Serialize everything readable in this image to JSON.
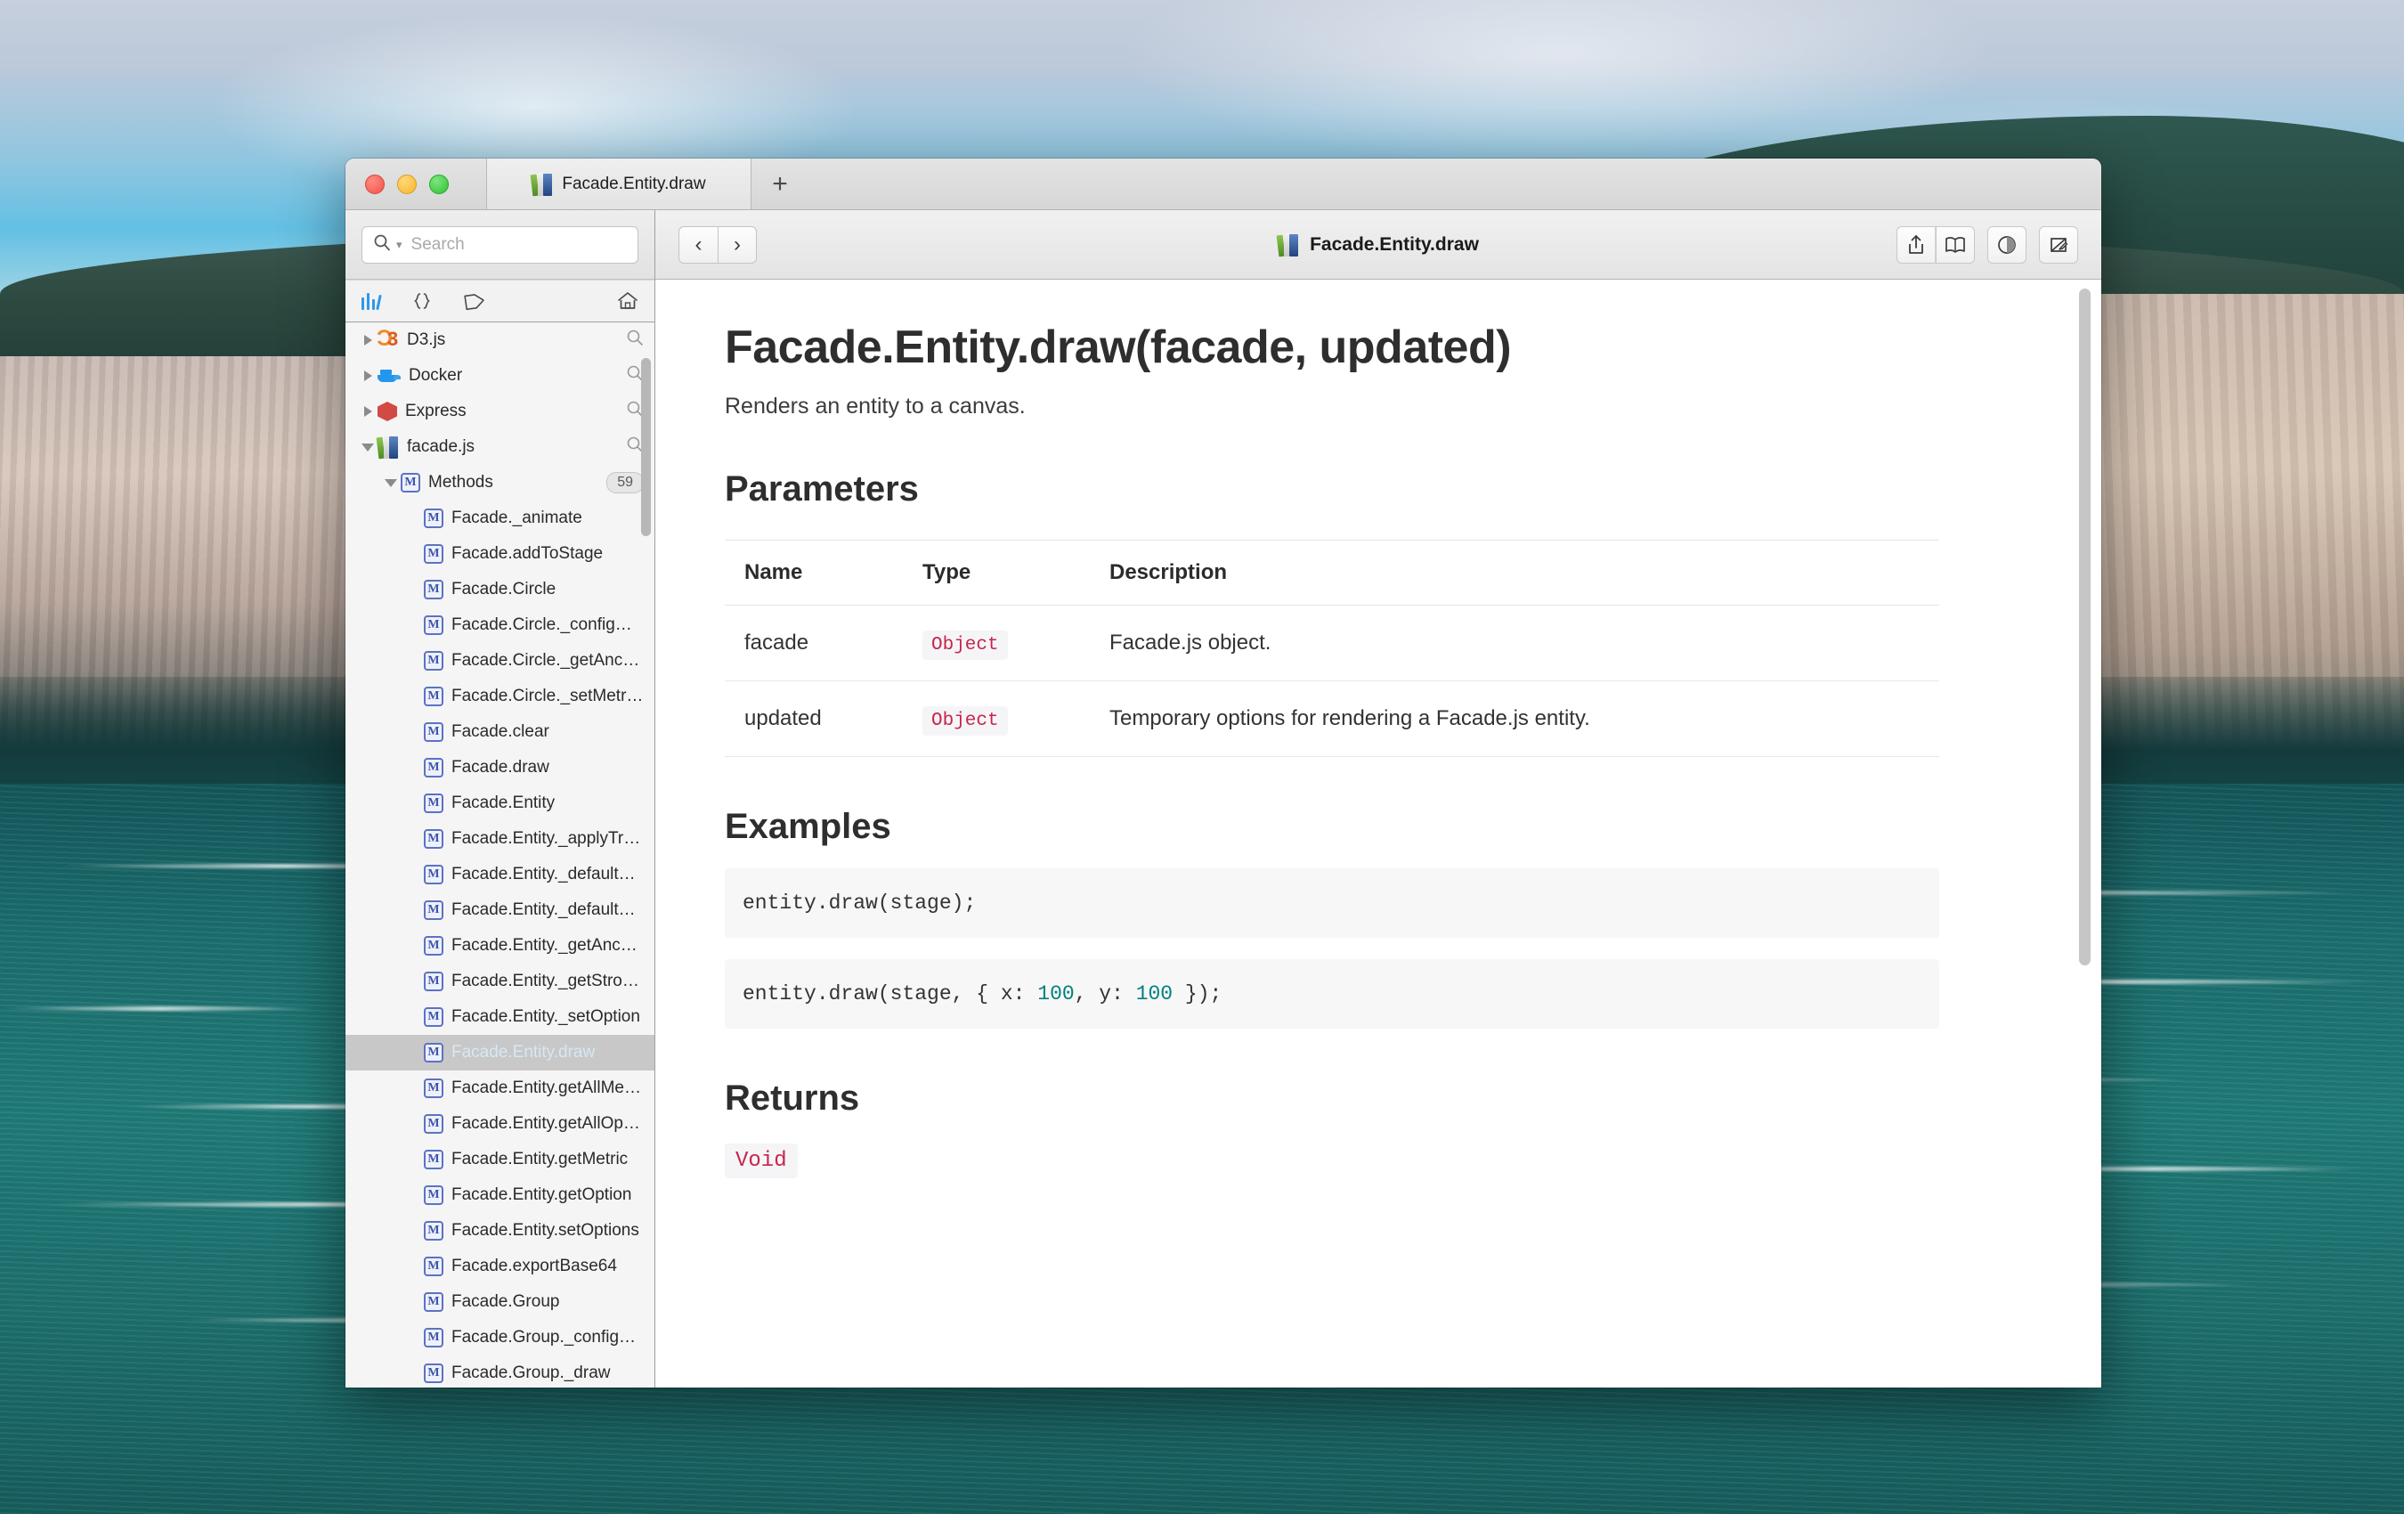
{
  "window": {
    "tab_title": "Facade.Entity.draw",
    "new_tab_label": "+"
  },
  "search": {
    "placeholder": "Search",
    "value": ""
  },
  "sidebar": {
    "toolbar": [
      {
        "name": "docsets-icon",
        "label": "Docsets"
      },
      {
        "name": "snippets-icon",
        "label": "Snippets"
      },
      {
        "name": "tags-icon",
        "label": "Tags"
      },
      {
        "name": "home-icon",
        "label": "Home"
      }
    ],
    "tree": [
      {
        "level": 0,
        "disclosure": "closed",
        "icon": "d3-icon",
        "label": "D3.js",
        "trailing": "search"
      },
      {
        "level": 0,
        "disclosure": "closed",
        "icon": "docker-icon",
        "label": "Docker",
        "trailing": "search"
      },
      {
        "level": 0,
        "disclosure": "closed",
        "icon": "express-icon",
        "label": "Express",
        "trailing": "search"
      },
      {
        "level": 0,
        "disclosure": "open",
        "icon": "books-icon",
        "label": "facade.js",
        "trailing": "search"
      },
      {
        "level": 1,
        "disclosure": "open",
        "icon": "method-icon",
        "label": "Methods",
        "trailing": "badge",
        "badge": "59"
      },
      {
        "level": 2,
        "disclosure": "none",
        "icon": "method-icon",
        "label": "Facade._animate"
      },
      {
        "level": 2,
        "disclosure": "none",
        "icon": "method-icon",
        "label": "Facade.addToStage"
      },
      {
        "level": 2,
        "disclosure": "none",
        "icon": "method-icon",
        "label": "Facade.Circle"
      },
      {
        "level": 2,
        "disclosure": "none",
        "icon": "method-icon",
        "label": "Facade.Circle._configOpti..."
      },
      {
        "level": 2,
        "disclosure": "none",
        "icon": "method-icon",
        "label": "Facade.Circle._getAnchor..."
      },
      {
        "level": 2,
        "disclosure": "none",
        "icon": "method-icon",
        "label": "Facade.Circle._setMetrics"
      },
      {
        "level": 2,
        "disclosure": "none",
        "icon": "method-icon",
        "label": "Facade.clear"
      },
      {
        "level": 2,
        "disclosure": "none",
        "icon": "method-icon",
        "label": "Facade.draw"
      },
      {
        "level": 2,
        "disclosure": "none",
        "icon": "method-icon",
        "label": "Facade.Entity"
      },
      {
        "level": 2,
        "disclosure": "none",
        "icon": "method-icon",
        "label": "Facade.Entity._applyTran..."
      },
      {
        "level": 2,
        "disclosure": "none",
        "icon": "method-icon",
        "label": "Facade.Entity._defaultMe..."
      },
      {
        "level": 2,
        "disclosure": "none",
        "icon": "method-icon",
        "label": "Facade.Entity._defaultOp..."
      },
      {
        "level": 2,
        "disclosure": "none",
        "icon": "method-icon",
        "label": "Facade.Entity._getAnchor..."
      },
      {
        "level": 2,
        "disclosure": "none",
        "icon": "method-icon",
        "label": "Facade.Entity._getStroke..."
      },
      {
        "level": 2,
        "disclosure": "none",
        "icon": "method-icon",
        "label": "Facade.Entity._setOption"
      },
      {
        "level": 2,
        "disclosure": "none",
        "icon": "method-icon",
        "label": "Facade.Entity.draw",
        "selected": true
      },
      {
        "level": 2,
        "disclosure": "none",
        "icon": "method-icon",
        "label": "Facade.Entity.getAllMetrics"
      },
      {
        "level": 2,
        "disclosure": "none",
        "icon": "method-icon",
        "label": "Facade.Entity.getAllOptio..."
      },
      {
        "level": 2,
        "disclosure": "none",
        "icon": "method-icon",
        "label": "Facade.Entity.getMetric"
      },
      {
        "level": 2,
        "disclosure": "none",
        "icon": "method-icon",
        "label": "Facade.Entity.getOption"
      },
      {
        "level": 2,
        "disclosure": "none",
        "icon": "method-icon",
        "label": "Facade.Entity.setOptions"
      },
      {
        "level": 2,
        "disclosure": "none",
        "icon": "method-icon",
        "label": "Facade.exportBase64"
      },
      {
        "level": 2,
        "disclosure": "none",
        "icon": "method-icon",
        "label": "Facade.Group"
      },
      {
        "level": 2,
        "disclosure": "none",
        "icon": "method-icon",
        "label": "Facade.Group._configOpt..."
      },
      {
        "level": 2,
        "disclosure": "none",
        "icon": "method-icon",
        "label": "Facade.Group._draw"
      }
    ]
  },
  "toolbar": {
    "back_label": "‹",
    "forward_label": "›",
    "title": "Facade.Entity.draw",
    "share_label": "Share",
    "bookmark_label": "Bookmarks",
    "appearance_label": "Appearance",
    "annotate_label": "Annotate"
  },
  "doc": {
    "title": "Facade.Entity.draw(facade, updated)",
    "description": "Renders an entity to a canvas.",
    "parameters_heading": "Parameters",
    "params_columns": [
      "Name",
      "Type",
      "Description"
    ],
    "params_rows": [
      {
        "name": "facade",
        "type": "Object",
        "description": "Facade.js object."
      },
      {
        "name": "updated",
        "type": "Object",
        "description": "Temporary options for rendering a Facade.js entity."
      }
    ],
    "examples_heading": "Examples",
    "examples": [
      {
        "pre": "entity.draw(stage);",
        "num1": "",
        "mid": "",
        "num2": "",
        "post": ""
      },
      {
        "pre": "entity.draw(stage, { x: ",
        "num1": "100",
        "mid": ", y: ",
        "num2": "100",
        "post": " });"
      }
    ],
    "returns_heading": "Returns",
    "returns_value": "Void"
  },
  "colors": {
    "accent": "#2c9ae8",
    "type_red": "#c7254e",
    "number_teal": "#008080",
    "selection_gray": "#c8c8c8"
  }
}
